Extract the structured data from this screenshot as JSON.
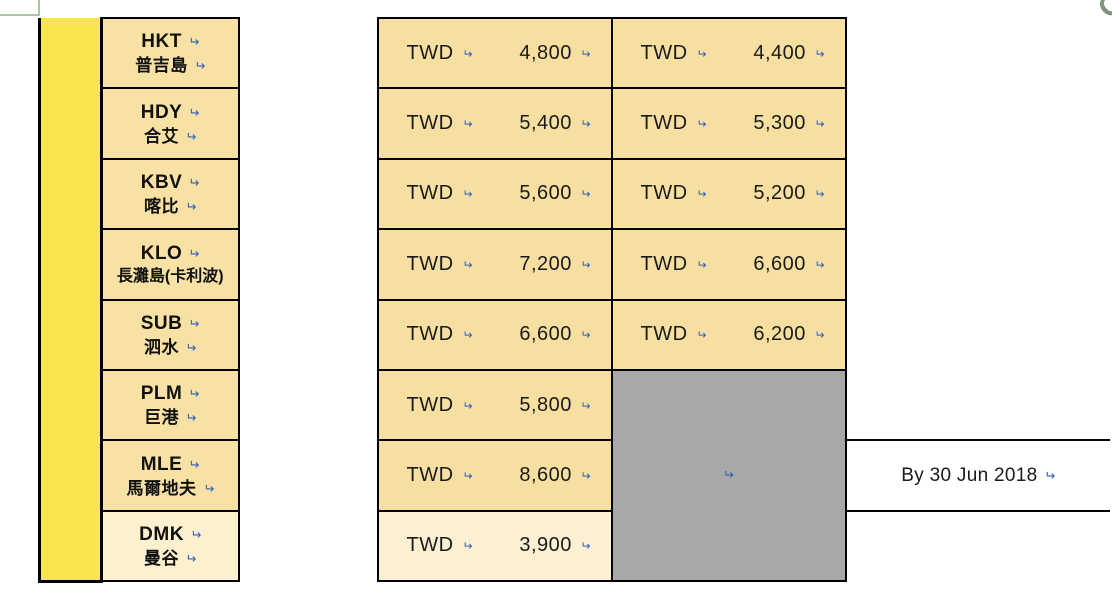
{
  "watermark": {
    "text": "OT"
  },
  "marks": {
    "paragraph": "↵"
  },
  "table": {
    "currency_label": "TWD",
    "rows": [
      {
        "code": "HKT",
        "name": "普吉島",
        "code_mark": true,
        "name_mark": true,
        "wide": false,
        "shade": "normal",
        "price_1": "4,800",
        "price_2": "4,400"
      },
      {
        "code": "HDY",
        "name": "合艾",
        "code_mark": true,
        "name_mark": true,
        "wide": false,
        "shade": "normal",
        "price_1": "5,400",
        "price_2": "5,300"
      },
      {
        "code": "KBV",
        "name": "喀比",
        "code_mark": true,
        "name_mark": true,
        "wide": false,
        "shade": "normal",
        "price_1": "5,600",
        "price_2": "5,200"
      },
      {
        "code": "KLO",
        "name": "長灘島(卡利波)",
        "code_mark": true,
        "name_mark": false,
        "wide": true,
        "shade": "normal",
        "price_1": "7,200",
        "price_2": "6,600"
      },
      {
        "code": "SUB",
        "name": "泗水",
        "code_mark": true,
        "name_mark": true,
        "wide": false,
        "shade": "normal",
        "price_1": "6,600",
        "price_2": "6,200"
      },
      {
        "code": "PLM",
        "name": "巨港",
        "code_mark": true,
        "name_mark": true,
        "wide": false,
        "shade": "normal",
        "price_1": "5,800",
        "price_2": null
      },
      {
        "code": "MLE",
        "name": "馬爾地夫",
        "code_mark": true,
        "name_mark": true,
        "wide": false,
        "shade": "normal",
        "price_1": "8,600",
        "price_2": null
      },
      {
        "code": "DMK",
        "name": "曼谷",
        "code_mark": true,
        "name_mark": true,
        "wide": false,
        "shade": "light",
        "price_1": "3,900",
        "price_2": null
      }
    ]
  },
  "validity": {
    "text": "By 30 Jun 2018"
  },
  "colors": {
    "yellow_bar": "#FBE54E",
    "cell_tan": "#F7E1A4",
    "cell_tan_light": "#FCF0CF",
    "grey_merged": "#A8A8A8",
    "border": "#000000",
    "paragraph_mark": "#2F5FBF",
    "watermark": "#7D8F78",
    "selection_marker": "#A8C5A0"
  }
}
